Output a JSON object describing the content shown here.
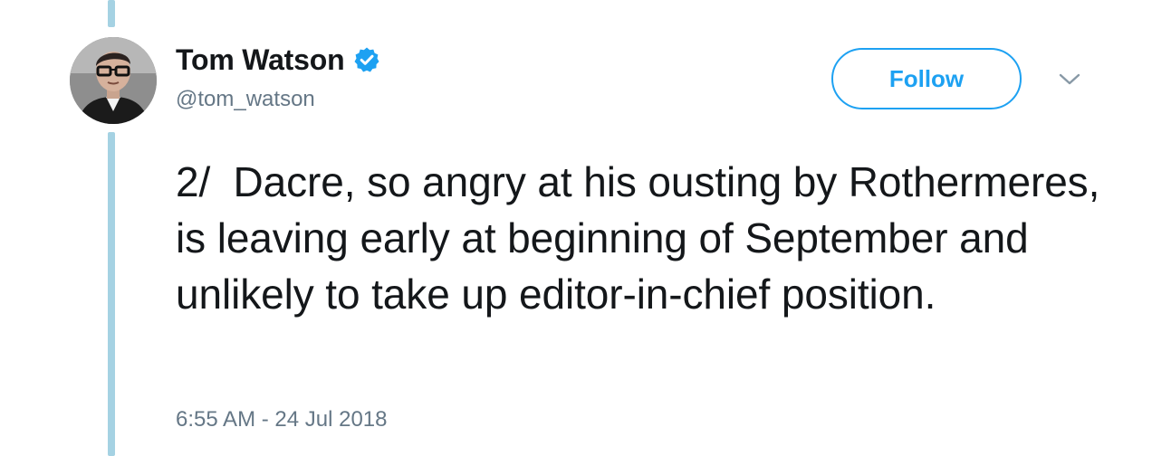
{
  "tweet": {
    "author": {
      "display_name": "Tom Watson",
      "handle": "@tom_watson",
      "verified": true,
      "avatar_alt": "Tom Watson profile photo"
    },
    "follow_label": "Follow",
    "menu_icon": "chevron-down-icon",
    "text": "2/  Dacre, so angry at his ousting by Rothermeres, is leaving early at beginning of September and unlikely to take up editor-in-chief position.",
    "timestamp": "6:55 AM - 24 Jul 2018"
  },
  "colors": {
    "accent": "#1da1f2",
    "thread_line": "#a5d2e3",
    "text_primary": "#14171a",
    "text_secondary": "#657786"
  }
}
